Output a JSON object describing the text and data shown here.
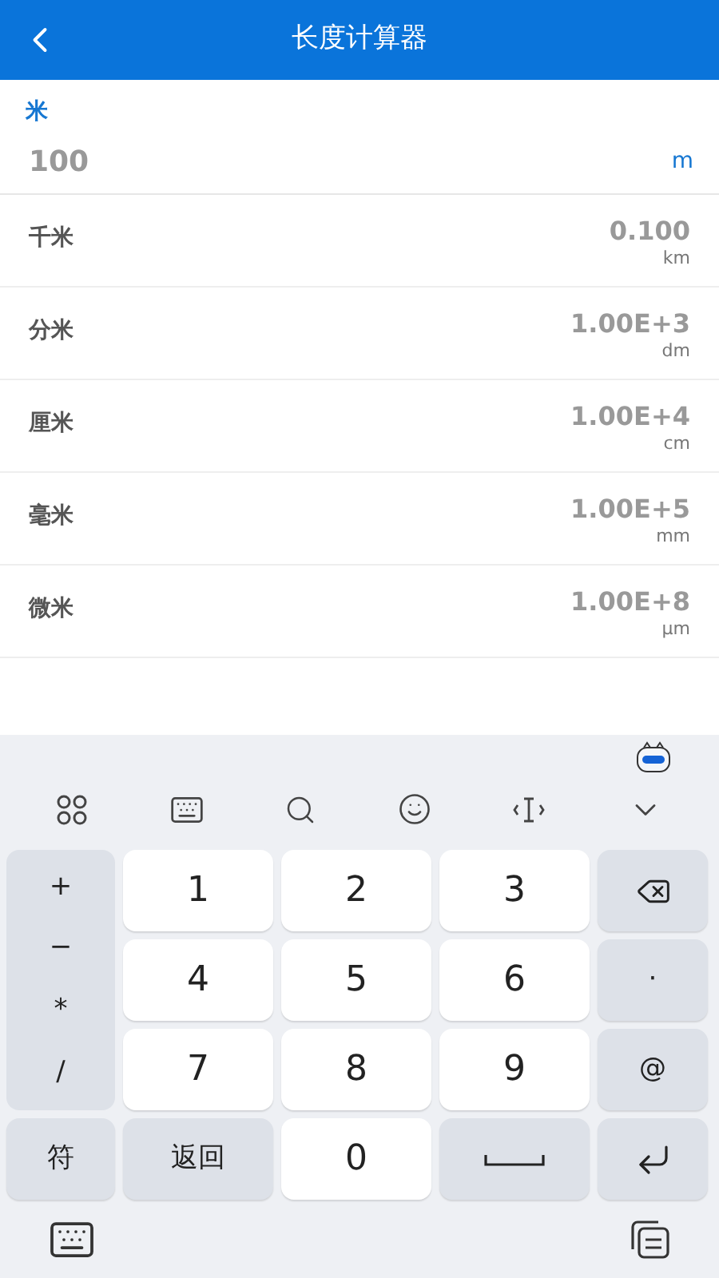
{
  "header": {
    "title": "长度计算器"
  },
  "input": {
    "label": "米",
    "value": "100",
    "unit": "m"
  },
  "results": [
    {
      "name": "千米",
      "value": "0.100",
      "unit": "km"
    },
    {
      "name": "分米",
      "value": "1.00E+3",
      "unit": "dm"
    },
    {
      "name": "厘米",
      "value": "1.00E+4",
      "unit": "cm"
    },
    {
      "name": "毫米",
      "value": "1.00E+5",
      "unit": "mm"
    },
    {
      "name": "微米",
      "value": "1.00E+8",
      "unit": "μm"
    }
  ],
  "keyboard": {
    "symbols": [
      "+",
      "−",
      "*",
      "/"
    ],
    "keys": [
      {
        "kind": "digit",
        "label": "1"
      },
      {
        "kind": "digit",
        "label": "2"
      },
      {
        "kind": "digit",
        "label": "3"
      },
      {
        "kind": "backspace"
      },
      {
        "kind": "digit",
        "label": "4"
      },
      {
        "kind": "digit",
        "label": "5"
      },
      {
        "kind": "digit",
        "label": "6"
      },
      {
        "kind": "function",
        "label": "·"
      },
      {
        "kind": "digit",
        "label": "7"
      },
      {
        "kind": "digit",
        "label": "8"
      },
      {
        "kind": "digit",
        "label": "9"
      },
      {
        "kind": "function",
        "label": "@"
      },
      {
        "kind": "function",
        "label": "符"
      },
      {
        "kind": "function",
        "label": "返回"
      },
      {
        "kind": "digit",
        "label": "0"
      },
      {
        "kind": "space"
      },
      {
        "kind": "enter"
      }
    ]
  }
}
